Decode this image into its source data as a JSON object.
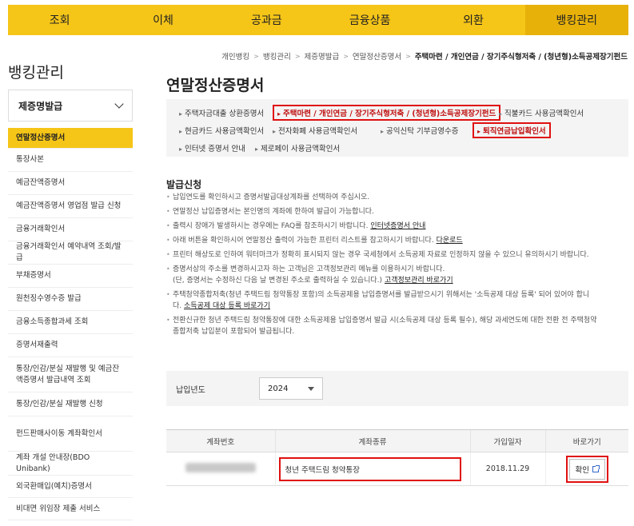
{
  "topnav": [
    "조회",
    "이체",
    "공과금",
    "금융상품",
    "외환",
    "뱅킹관리"
  ],
  "sidebar": {
    "title": "뱅킹관리",
    "group": "제증명발급",
    "items": [
      "연말정산증명서",
      "통장사본",
      "예금잔액증명서",
      "예금잔액증명서 영업점 발급 신청",
      "금융거래확인서",
      "금융거래확인서 예약내역 조회/발급",
      "부채증명서",
      "원천징수영수증 발급",
      "금융소득종합과세 조회",
      "증명서재출력",
      "통장/인감/분실 재발행 및 예금잔액증명서 발급내역 조회",
      "통장/인감/분실 재발행 신청",
      "펀드판매사이동 계좌확인서",
      "계좌 개설 안내장(BDO Unibank)",
      "외국환매입(예치)증명서",
      "비대면 위임장 제출 서비스"
    ]
  },
  "breadcrumb": [
    "개인뱅킹",
    "뱅킹관리",
    "제증명발급",
    "연말정산증명서",
    "주택마련 / 개인연금 / 장기주식형저축 / (청년형)소득공제장기펀드"
  ],
  "page_title": "연말정산증명서",
  "links": [
    "주택자금대출 상환증명서",
    "주택마련 / 개인연금 / 장기주식형저축 / (청년형)소득공제장기펀드",
    "직불카드 사용금액확인서",
    "현금카드 사용금액확인서",
    "전자화폐 사용금액확인서",
    "공익신탁 기부금영수증",
    "퇴직연금납입확인서",
    "인터넷 증명서 안내",
    "제로페이 사용금액확인서"
  ],
  "info": {
    "title": "발급신청",
    "items": {
      "i1": "납입연도를 확인하시고 증명서발급대상계좌를 선택하여 주십시오.",
      "i2": "연말정산 납입증명서는 본인명의 계좌에 한하여 발급이 가능합니다.",
      "i3": "출력시 장애가 발생하시는 경우에는 FAQ를 참조하시기 바랍니다.",
      "i3_link": "인터넷증명서 안내",
      "i4": "아래 버튼을 확인하시어 연말정산 출력이 가능한 프린터 리스트를 참고하시기 바랍니다.",
      "i4_link": "다운로드",
      "i5": "프린터 해상도로 인하여 워터마크가 정확히 표시되지 않는 경우 국세청에서 소득공제 자료로 인정하지 않을 수 있으니 유의하시기 바랍니다.",
      "i6": "증명서상의 주소를 변경하시고자 하는 고객님은 고객정보관리 메뉴를 이용하시기 바랍니다.",
      "i6b": "(단, 증명서는 수정하신 다음 날 변경된 주소로 출력하실 수 있습니다.)",
      "i6_link": "고객정보관리 바로가기",
      "i7": "주택청약종합저축(청년 주택드림 청약통장 포함)의 소득공제용 납입증명서를 발급받으시기 위해서는 '소득공제 대상 등록' 되어 있어야 합니다.",
      "i7_link": "소득공제 대상 등록 바로가기",
      "i8": "전환신규한 청년 주택드림 청약통장에 대한 소득공제용 납입증명서 발급 시(소득공제 대상 등록 필수), 해당 과세연도에 대한 전환 전 주택청약종합저축 납입분이 포함되어 발급됩니다."
    }
  },
  "year": {
    "label": "납입년도",
    "value": "2024"
  },
  "table": {
    "headers": [
      "계좌번호",
      "계좌종류",
      "가입일자",
      "바로가기"
    ],
    "row": {
      "product": "청년 주택드림 청약통장",
      "date": "2018.11.29",
      "button": "확인"
    }
  },
  "colors": {
    "accent": "#f5c518",
    "highlight": "#e01010"
  }
}
